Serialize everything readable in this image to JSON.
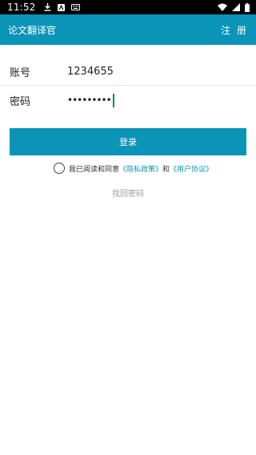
{
  "status_bar": {
    "time": "11:52",
    "icons": [
      "download-icon",
      "app-notification-icon",
      "keyboard-icon",
      "wifi-icon",
      "cellular-signal-icon",
      "battery-icon"
    ]
  },
  "app_bar": {
    "title": "论文翻译官",
    "register_label": "注 册",
    "background_color": "#0a94b7"
  },
  "form": {
    "account_label": "账号",
    "account_value": "1234655",
    "password_label": "密码",
    "password_value": "•••••••••"
  },
  "login_button_label": "登录",
  "agreement": {
    "prefix": "我已阅读和同意",
    "privacy_link": "《隐私政策》",
    "conjunction": "和",
    "user_agreement_link": "《用户协议》"
  },
  "forgot_password": "找回密码"
}
